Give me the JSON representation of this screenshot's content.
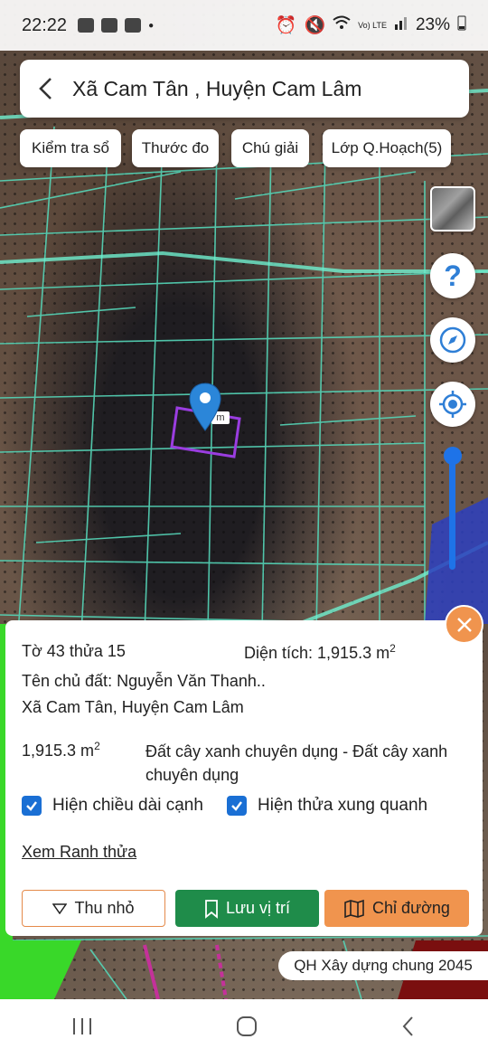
{
  "status": {
    "time": "22:22",
    "battery": "23%",
    "network": "Vo) LTE"
  },
  "header": {
    "title": "Xã Cam Tân , Huyện Cam Lâm"
  },
  "chips": [
    {
      "label": "Kiểm tra sổ"
    },
    {
      "label": "Thước đo"
    },
    {
      "label": "Chú giải"
    },
    {
      "label": "Lớp Q.Hoạch(5)"
    }
  ],
  "map": {
    "help_symbol": "?",
    "parcel_label": "m",
    "zoom_level_fraction": 0.95
  },
  "info": {
    "parcel_id": "Tờ 43 thửa 15",
    "area_label": "Diện tích: 1,915.3 m",
    "area_sup": "2",
    "owner": "Tên chủ đất: Nguyễn Văn Thanh..",
    "location": "Xã Cam Tân, Huyện Cam Lâm",
    "land_area": "1,915.3 m",
    "land_area_sup": "2",
    "land_use": "Đất cây xanh chuyên dụng - Đất cây xanh chuyên dụng",
    "show_edge_length": "Hiện chiều dài cạnh",
    "show_neighbors": "Hiện thửa xung quanh",
    "view_boundary_link": "Xem Ranh thửa"
  },
  "actions": {
    "shrink": "Thu nhỏ",
    "save_location": "Lưu vị trí",
    "directions": "Chỉ đường"
  },
  "plan_badge": "QH Xây dựng chung 2045",
  "colors": {
    "parcel_lines": "#55d6b8",
    "selected_parcel": "#9a3de0",
    "accent": "#1f8c4a",
    "orange": "#f0944e",
    "link": "#2a7fd6",
    "parcel_id": "#6aaa2c"
  }
}
